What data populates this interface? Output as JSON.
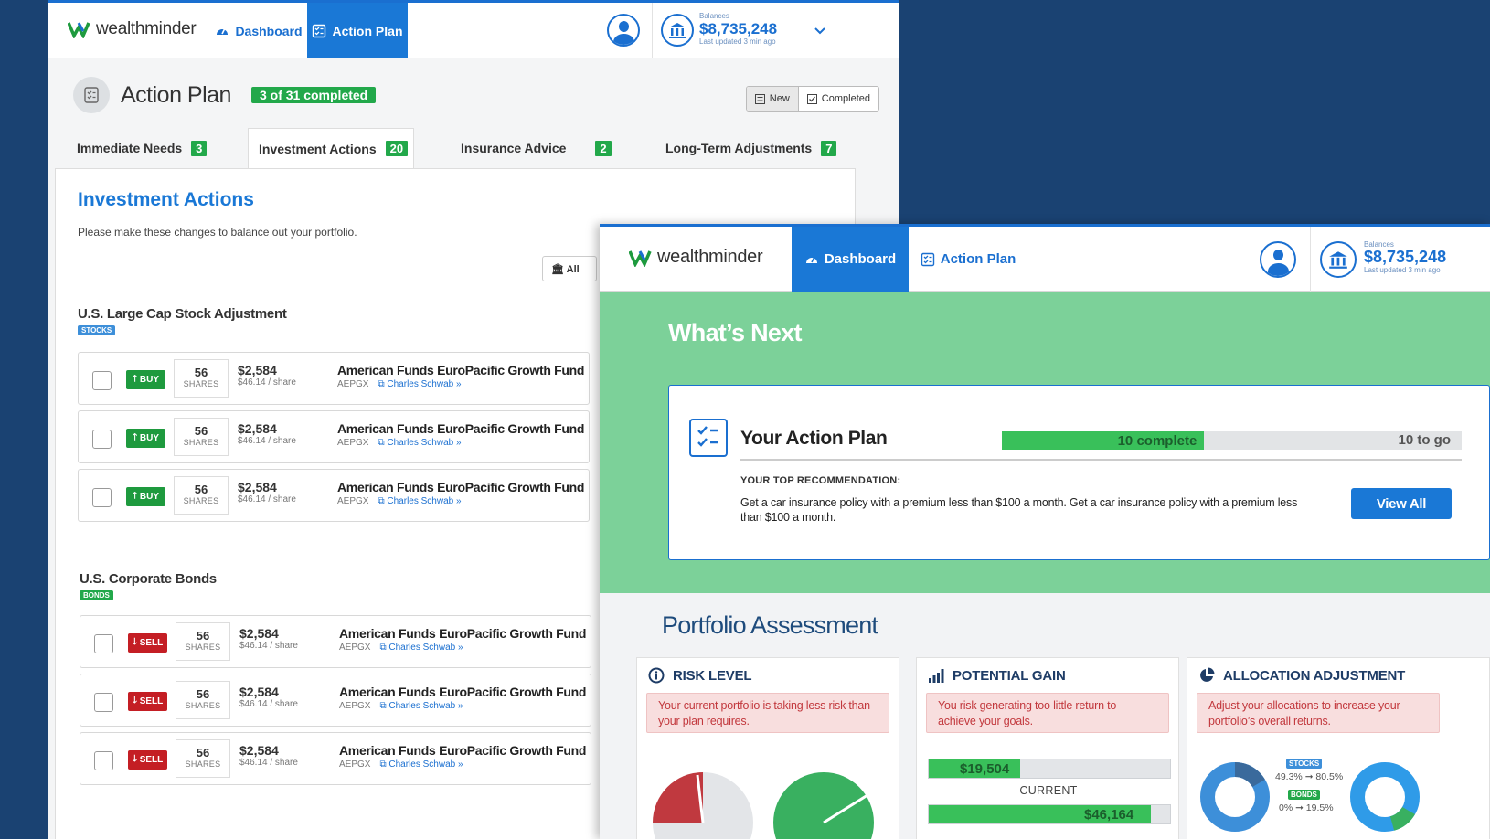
{
  "back_window": {
    "logo_text": "wealthminder",
    "nav": {
      "dashboard": "Dashboard",
      "action_plan": "Action Plan"
    },
    "balance": {
      "label": "Balances",
      "amount": "$8,735,248",
      "updated": "Last updated 3 min ago"
    },
    "page_title": "Action Plan",
    "completed_badge": "3 of 31 completed",
    "toggle": {
      "new": "New",
      "completed": "Completed"
    },
    "tabs": [
      {
        "label": "Immediate Needs",
        "count": "3"
      },
      {
        "label": "Investment Actions",
        "count": "20"
      },
      {
        "label": "Insurance Advice",
        "count": "2"
      },
      {
        "label": "Long-Term Adjustments",
        "count": "7"
      }
    ],
    "section_title": "Investment Actions",
    "section_desc": "Please make these changes to balance out your portfolio.",
    "all_button": "All",
    "groups": [
      {
        "title": "U.S. Large Cap Stock Adjustment",
        "tag": "STOCKS",
        "rows": [
          {
            "action": "BUY",
            "shares": "56",
            "shares_label": "SHARES",
            "price": "$2,584",
            "per_share": "$46.14 / share",
            "fund": "American Funds EuroPacific Growth Fund",
            "ticker": "AEPGX",
            "broker": "Charles Schwab »"
          },
          {
            "action": "BUY",
            "shares": "56",
            "shares_label": "SHARES",
            "price": "$2,584",
            "per_share": "$46.14 / share",
            "fund": "American Funds EuroPacific Growth Fund",
            "ticker": "AEPGX",
            "broker": "Charles Schwab »"
          },
          {
            "action": "BUY",
            "shares": "56",
            "shares_label": "SHARES",
            "price": "$2,584",
            "per_share": "$46.14 / share",
            "fund": "American Funds EuroPacific Growth Fund",
            "ticker": "AEPGX",
            "broker": "Charles Schwab »"
          }
        ]
      },
      {
        "title": "U.S. Corporate Bonds",
        "tag": "BONDS",
        "rows": [
          {
            "action": "SELL",
            "shares": "56",
            "shares_label": "SHARES",
            "price": "$2,584",
            "per_share": "$46.14 / share",
            "fund": "American Funds EuroPacific Growth Fund",
            "ticker": "AEPGX",
            "broker": "Charles Schwab »"
          },
          {
            "action": "SELL",
            "shares": "56",
            "shares_label": "SHARES",
            "price": "$2,584",
            "per_share": "$46.14 / share",
            "fund": "American Funds EuroPacific Growth Fund",
            "ticker": "AEPGX",
            "broker": "Charles Schwab »"
          },
          {
            "action": "SELL",
            "shares": "56",
            "shares_label": "SHARES",
            "price": "$2,584",
            "per_share": "$46.14 / share",
            "fund": "American Funds EuroPacific Growth Fund",
            "ticker": "AEPGX",
            "broker": "Charles Schwab »"
          }
        ]
      }
    ]
  },
  "front_window": {
    "logo_text": "wealthminder",
    "nav": {
      "dashboard": "Dashboard",
      "action_plan": "Action Plan"
    },
    "balance": {
      "label": "Balances",
      "amount": "$8,735,248",
      "updated": "Last updated 3 min ago"
    },
    "hero_title": "What’s Next",
    "action_plan": {
      "title": "Your Action Plan",
      "complete": "10 complete",
      "to_go": "10 to go",
      "progress_fraction": 0.44,
      "rec_label": "YOUR TOP RECOMMENDATION:",
      "rec_text": "Get a car insurance policy with a premium less than $100 a month. Get a car insurance policy with a premium less than $100 a month.",
      "view_all": "View All"
    },
    "assessment_title": "Portfolio Assessment",
    "cards": {
      "risk": {
        "title": "RISK LEVEL",
        "warning": "Your current portfolio is taking less risk than your plan requires."
      },
      "gain": {
        "title": "POTENTIAL GAIN",
        "warning": "You risk generating too little return to achieve your goals.",
        "current_value": "$19,504",
        "current_label": "CURRENT",
        "target_value": "$46,164",
        "current_fraction": 0.38,
        "target_fraction": 0.92
      },
      "alloc": {
        "title": "ALLOCATION ADJUSTMENT",
        "warning": "Adjust your allocations to increase your portfolio’s overall returns.",
        "stocks_tag": "STOCKS",
        "stocks_change": "49.3% ➞ 80.5%",
        "bonds_tag": "BONDS",
        "bonds_change": "0% ➞ 19.5%"
      }
    }
  },
  "colors": {
    "brand_blue": "#1a78d6",
    "navy_bg": "#1a4272",
    "buy_green": "#1e9a3e",
    "sell_red": "#c41e24",
    "hero_green": "#7cd199"
  },
  "icons": [
    "wealthminder-logo-icon",
    "gauge-icon",
    "checklist-icon",
    "user-avatar-icon",
    "bank-icon",
    "chevron-down-icon",
    "link-icon",
    "info-icon",
    "bar-chart-icon",
    "pie-chart-icon"
  ]
}
